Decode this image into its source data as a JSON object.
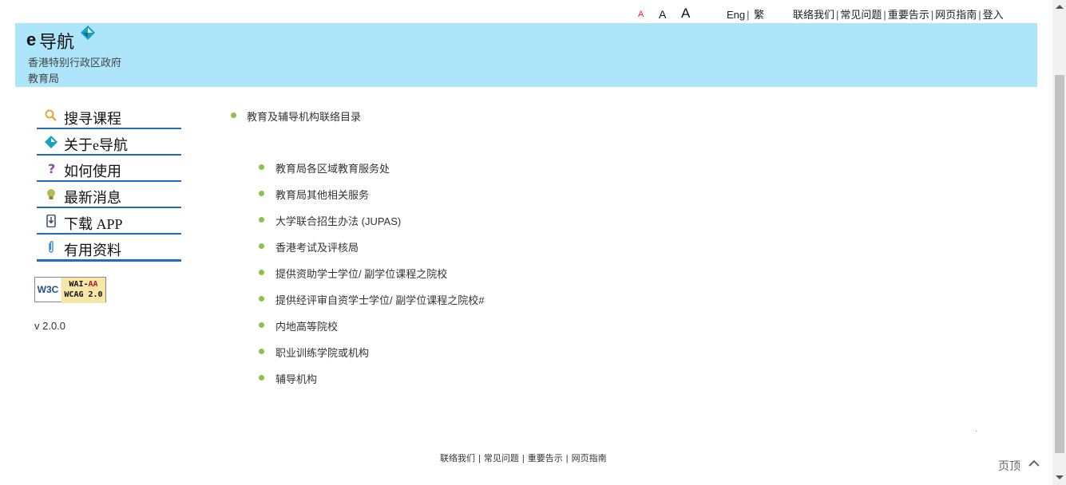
{
  "font_size_controls": [
    "A",
    "A",
    "A"
  ],
  "lang": {
    "english": "Eng",
    "traditional": "繁"
  },
  "top_links": [
    "联络我们",
    "常见问题",
    "重要告示",
    "网页指南",
    "登入"
  ],
  "header": {
    "logo_e": "e",
    "logo_text": "导航",
    "subtitle_1": "香港特别行政区政府",
    "subtitle_2": "教育局",
    "band_color": "#ade6fb"
  },
  "sidebar": {
    "items": [
      {
        "label": "搜寻课程",
        "icon": "magnifier-icon"
      },
      {
        "label": "关于e导航",
        "icon": "enav-logo-icon"
      },
      {
        "label": "如何使用",
        "icon": "question-icon"
      },
      {
        "label": "最新消息",
        "icon": "lightbulb-icon"
      },
      {
        "label": "下载 APP",
        "icon": "phone-download-icon"
      },
      {
        "label": "有用资料",
        "icon": "paperclip-icon"
      }
    ],
    "badge_left": "W3C",
    "badge_line1": "WAI-",
    "badge_aa": "AA",
    "badge_line2": "WCAG 2.0",
    "version": "v 2.0.0",
    "accent_color": "#1e6fb8"
  },
  "main": {
    "heading": "教育及辅导机构联络目录",
    "links": [
      "教育局各区域教育服务处",
      "教育局其他相关服务",
      "大学联合招生办法 (JUPAS)",
      "香港考试及评核局",
      "提供资助学士学位/ 副学位课程之院校",
      "提供经评审自资学士学位/ 副学位课程之院校#",
      "内地高等院校",
      "职业训练学院或机构",
      "辅导机构"
    ],
    "bullet_color": "#8cc14c"
  },
  "footer": {
    "links": [
      "联络我们",
      "常见问题",
      "重要告示",
      "网页指南"
    ]
  },
  "back_to_top": "页顶"
}
